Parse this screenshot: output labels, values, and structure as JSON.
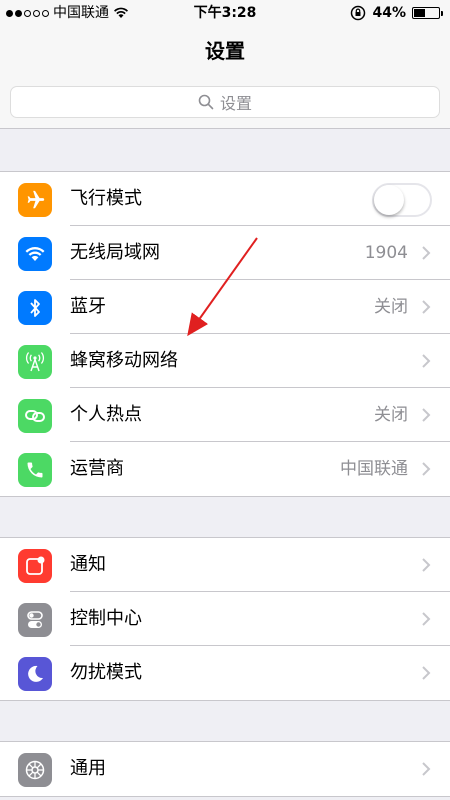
{
  "status_bar": {
    "carrier": "中国联通",
    "time": "下午3:28",
    "battery_text": "44%",
    "battery_level": 0.44
  },
  "nav": {
    "title": "设置"
  },
  "search": {
    "placeholder": "设置"
  },
  "group1": [
    {
      "label": "飞行模式",
      "icon": "airplane-icon",
      "color": "#ff9500",
      "toggle": true,
      "toggle_on": false
    },
    {
      "label": "无线局域网",
      "value": "1904",
      "icon": "wifi-icon",
      "color": "#007aff"
    },
    {
      "label": "蓝牙",
      "value": "关闭",
      "icon": "bluetooth-icon",
      "color": "#007aff"
    },
    {
      "label": "蜂窝移动网络",
      "value": "",
      "icon": "cellular-icon",
      "color": "#4cd964"
    },
    {
      "label": "个人热点",
      "value": "关闭",
      "icon": "hotspot-icon",
      "color": "#4cd964"
    },
    {
      "label": "运营商",
      "value": "中国联通",
      "icon": "phone-icon",
      "color": "#4cd964"
    }
  ],
  "group2": [
    {
      "label": "通知",
      "icon": "notification-icon",
      "color": "#ff3b30"
    },
    {
      "label": "控制中心",
      "icon": "control-center-icon",
      "color": "#8e8e93"
    },
    {
      "label": "勿扰模式",
      "icon": "moon-icon",
      "color": "#5856d6"
    }
  ],
  "group3": [
    {
      "label": "通用",
      "icon": "gear-icon",
      "color": "#8e8e93"
    }
  ],
  "annotation": {
    "color": "#e02020"
  }
}
